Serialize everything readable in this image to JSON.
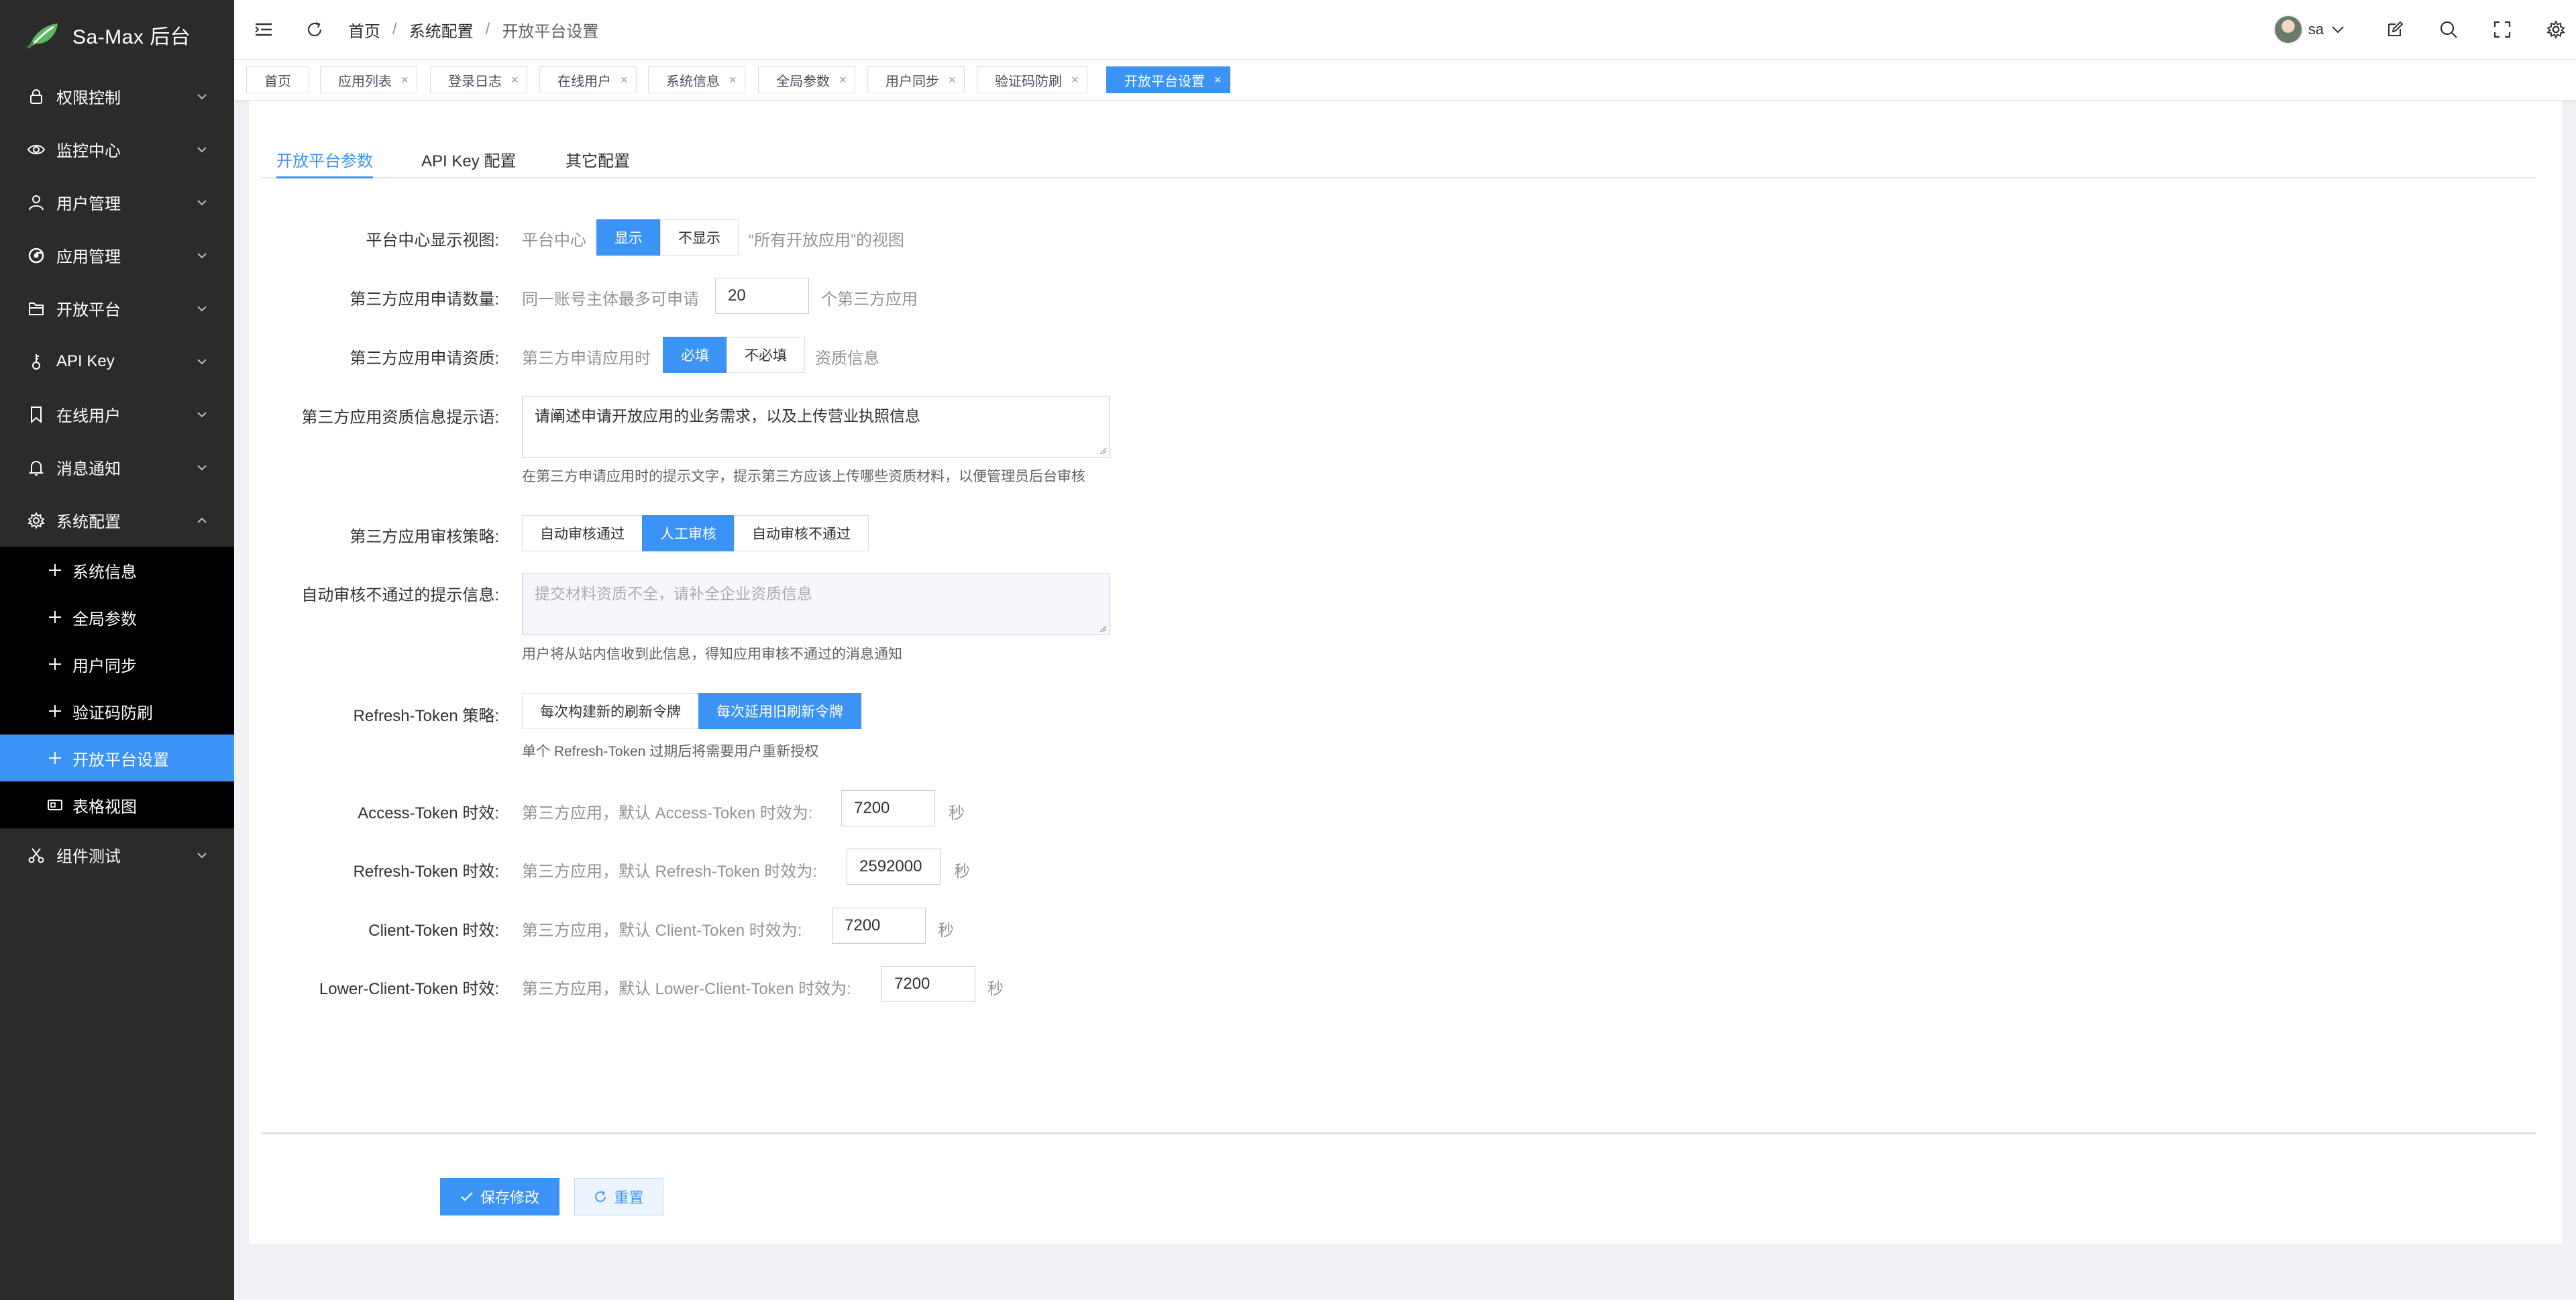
{
  "app": {
    "title": "Sa-Max 后台"
  },
  "sidebar": {
    "items": [
      {
        "label": "权限控制",
        "icon": "lock-icon"
      },
      {
        "label": "监控中心",
        "icon": "eye-icon"
      },
      {
        "label": "用户管理",
        "icon": "user-icon"
      },
      {
        "label": "应用管理",
        "icon": "chrome-icon"
      },
      {
        "label": "开放平台",
        "icon": "folder-icon"
      },
      {
        "label": "API Key",
        "icon": "key-icon"
      },
      {
        "label": "在线用户",
        "icon": "bookmark-icon"
      },
      {
        "label": "消息通知",
        "icon": "bell-icon"
      },
      {
        "label": "系统配置",
        "icon": "gear-icon"
      }
    ],
    "subitems": [
      {
        "label": "系统信息"
      },
      {
        "label": "全局参数"
      },
      {
        "label": "用户同步"
      },
      {
        "label": "验证码防刷"
      },
      {
        "label": "开放平台设置"
      },
      {
        "label": "表格视图"
      }
    ],
    "last_item": {
      "label": "组件测试",
      "icon": "scissors-icon"
    }
  },
  "breadcrumb": [
    "首页",
    "系统配置",
    "开放平台设置"
  ],
  "user": {
    "name": "sa"
  },
  "tabs": [
    "首页",
    "应用列表",
    "登录日志",
    "在线用户",
    "系统信息",
    "全局参数",
    "用户同步",
    "验证码防刷",
    "开放平台设置"
  ],
  "form_tabs": [
    "开放平台参数",
    "API Key 配置",
    "其它配置"
  ],
  "form": {
    "view": {
      "label": "平台中心显示视图:",
      "prefix": "平台中心",
      "options": [
        "显示",
        "不显示"
      ],
      "suffix": "“所有开放应用”的视图",
      "selected": "显示"
    },
    "apply_count": {
      "label": "第三方应用申请数量:",
      "prefix": "同一账号主体最多可申请",
      "value": "20",
      "suffix": "个第三方应用"
    },
    "qualification": {
      "label": "第三方应用申请资质:",
      "prefix": "第三方申请应用时",
      "options": [
        "必填",
        "不必填"
      ],
      "suffix": "资质信息",
      "selected": "必填"
    },
    "qual_tip": {
      "label": "第三方应用资质信息提示语:",
      "value": "请阐述申请开放应用的业务需求，以及上传营业执照信息",
      "help": "在第三方申请应用时的提示文字，提示第三方应该上传哪些资质材料，以便管理员后台审核"
    },
    "audit": {
      "label": "第三方应用审核策略:",
      "options": [
        "自动审核通过",
        "人工审核",
        "自动审核不通过"
      ],
      "selected": "人工审核"
    },
    "reject_msg": {
      "label": "自动审核不通过的提示信息:",
      "placeholder": "提交材料资质不全，请补全企业资质信息",
      "help": "用户将从站内信收到此信息，得知应用审核不通过的消息通知"
    },
    "refresh_policy": {
      "label": "Refresh-Token 策略:",
      "options": [
        "每次构建新的刷新令牌",
        "每次延用旧刷新令牌"
      ],
      "selected": "每次延用旧刷新令牌",
      "help": "单个 Refresh-Token 过期后将需要用户重新授权"
    },
    "access_ttl": {
      "label": "Access-Token 时效:",
      "prefix": "第三方应用，默认 Access-Token 时效为:",
      "value": "7200",
      "unit": "秒"
    },
    "refresh_ttl": {
      "label": "Refresh-Token 时效:",
      "prefix": "第三方应用，默认 Refresh-Token 时效为:",
      "value": "2592000",
      "unit": "秒"
    },
    "client_ttl": {
      "label": "Client-Token 时效:",
      "prefix": "第三方应用，默认 Client-Token 时效为:",
      "value": "7200",
      "unit": "秒"
    },
    "lower_client_ttl": {
      "label": "Lower-Client-Token 时效:",
      "prefix": "第三方应用，默认 Lower-Client-Token 时效为:",
      "value": "7200",
      "unit": "秒"
    }
  },
  "actions": {
    "save": "保存修改",
    "reset": "重置"
  },
  "colors": {
    "primary": "#3a93f5",
    "sidebar_bg": "#2b2b2b",
    "submenu_bg": "#000000"
  }
}
